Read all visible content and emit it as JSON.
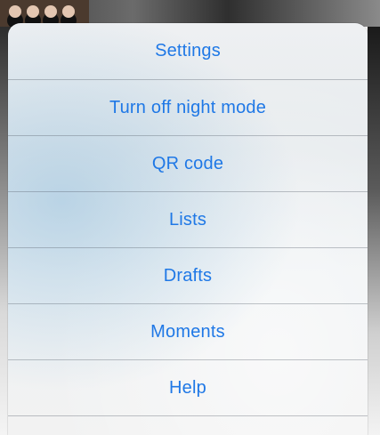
{
  "menu": {
    "items": [
      {
        "label": "Settings"
      },
      {
        "label": "Turn off night mode"
      },
      {
        "label": "QR code"
      },
      {
        "label": "Lists"
      },
      {
        "label": "Drafts"
      },
      {
        "label": "Moments"
      },
      {
        "label": "Help"
      }
    ]
  },
  "colors": {
    "accent": "#1f78e6",
    "divider": "#5a6470"
  }
}
